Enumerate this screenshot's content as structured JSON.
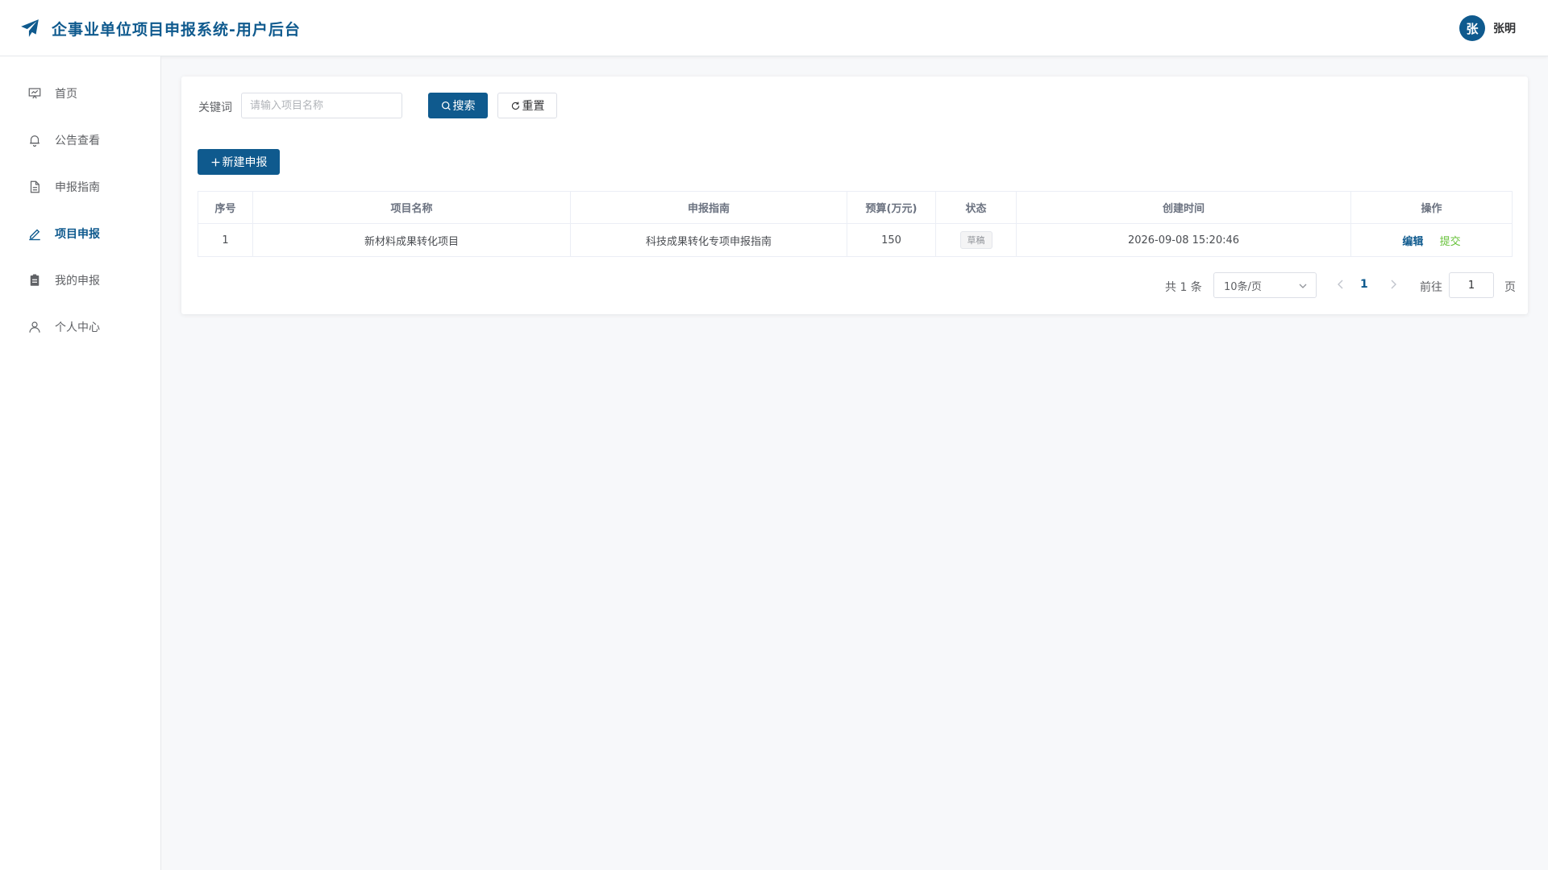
{
  "header": {
    "title": "企事业单位项目申报系统-用户后台",
    "avatar_letter": "张",
    "username": "张明"
  },
  "sidebar": {
    "items": [
      {
        "label": "首页",
        "icon": "presentation-icon",
        "active": false
      },
      {
        "label": "公告查看",
        "icon": "bell-icon",
        "active": false
      },
      {
        "label": "申报指南",
        "icon": "document-icon",
        "active": false
      },
      {
        "label": "项目申报",
        "icon": "edit-pen-icon",
        "active": true
      },
      {
        "label": "我的申报",
        "icon": "clipboard-icon",
        "active": false
      },
      {
        "label": "个人中心",
        "icon": "user-icon",
        "active": false
      }
    ]
  },
  "filter": {
    "label": "关键词",
    "placeholder": "请输入项目名称",
    "value": "",
    "search_label": "搜索",
    "reset_label": "重置"
  },
  "toolbar": {
    "new_label": "新建申报"
  },
  "table": {
    "columns": [
      "序号",
      "项目名称",
      "申报指南",
      "预算(万元)",
      "状态",
      "创建时间",
      "操作"
    ],
    "rows": [
      {
        "index": "1",
        "name": "新材料成果转化项目",
        "guide": "科技成果转化专项申报指南",
        "budget": "150",
        "status": "草稿",
        "created": "2026-09-08 15:20:46",
        "op_edit": "编辑",
        "op_submit": "提交"
      }
    ]
  },
  "pagination": {
    "total_text": "共 1 条",
    "page_size": "10条/页",
    "current_page": "1",
    "goto_label": "前往",
    "goto_value": "1",
    "goto_suffix": "页"
  },
  "colors": {
    "primary": "#0f5a8e",
    "success": "#67c23a",
    "background": "#f7f8fa"
  }
}
